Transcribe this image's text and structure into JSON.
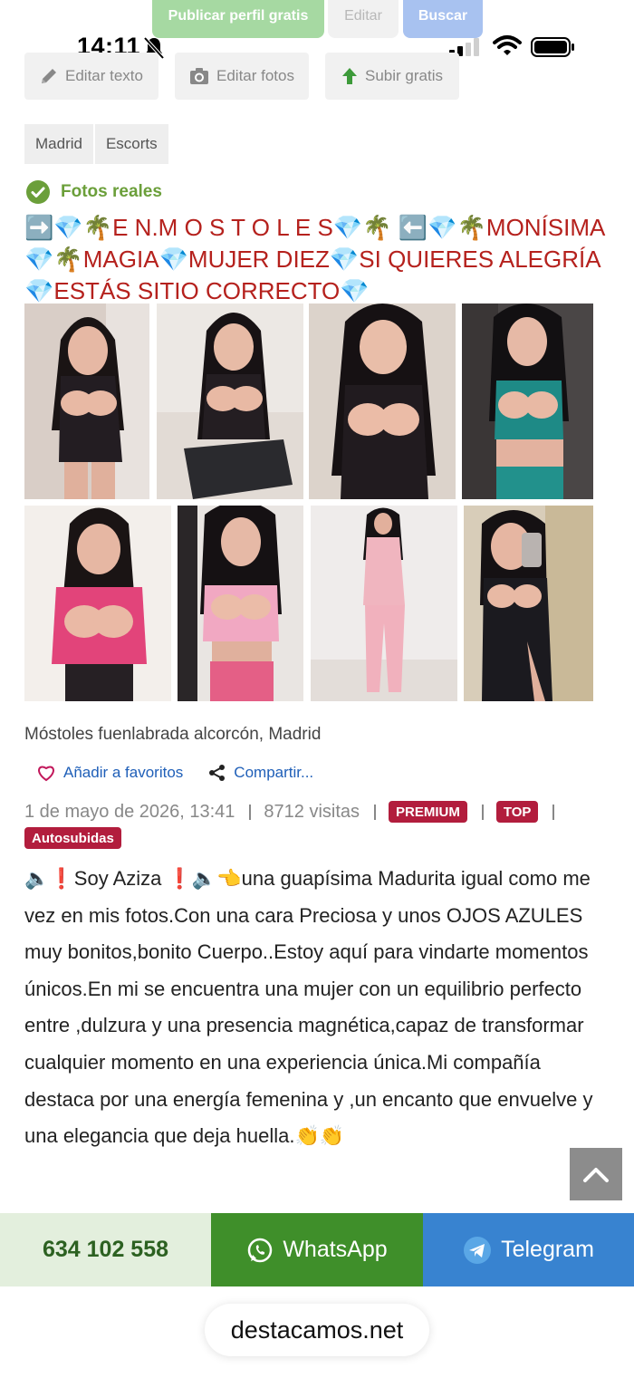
{
  "top_actions": {
    "publish_label": "Publicar perfil gratis",
    "edit_label": "Editar",
    "search_label": "Buscar"
  },
  "status_bar": {
    "time": "14:11"
  },
  "edit_toolbar": {
    "edit_text": "Editar texto",
    "edit_photos": "Editar fotos",
    "upload_free": "Subir gratis"
  },
  "breadcrumb": [
    "Madrid",
    "Escorts"
  ],
  "verified_label": "Fotos reales",
  "title": "➡️💎🌴E N.M O S T O L E S💎🌴 ⬅️💎🌴MONÍSIMA 💎🌴MAGIA💎MUJER DIEZ💎SI QUIERES ALEGRÍA 💎ESTÁS SITIO CORRECTO💎",
  "location": "Móstoles fuenlabrada alcorcón, Madrid",
  "actions": {
    "favorite": "Añadir a favoritos",
    "share": "Compartir..."
  },
  "meta": {
    "date": "1 de mayo de 2026, 13:41",
    "visits": "8712 visitas",
    "badges": [
      "PREMIUM",
      "TOP",
      "Autosubidas"
    ]
  },
  "description": "🔈❗Soy Aziza ❗🔈👈una guapísima Madurita igual como me vez en mis fotos.Con una cara Preciosa y unos OJOS AZULES muy bonitos,bonito Cuerpo..Estoy aquí para vindarte momentos únicos.En mi se encuentra una mujer con un equilibrio perfecto entre ,dulzura y una presencia magnética,capaz de transformar cualquier momento en una experiencia única.Mi compañía destaca por una energía femenina y ,un encanto que envuelve y una elegancia que deja huella.👏👏",
  "contact": {
    "phone": "634 102 558",
    "whatsapp": "WhatsApp",
    "telegram": "Telegram"
  },
  "browser": {
    "url": "destacamos.net"
  },
  "colors": {
    "title_red": "#b5211d",
    "verified_green": "#6b9f3a",
    "badge_red": "#b21d3d",
    "whatsapp_green": "#3f8f2a",
    "telegram_blue": "#3883d0",
    "link_blue": "#1f5fb8"
  },
  "icons": [
    "pencil-icon",
    "camera-icon",
    "arrow-up-icon",
    "check-circle-icon",
    "heart-icon",
    "share-icon",
    "chevron-up-icon",
    "whatsapp-icon",
    "telegram-icon",
    "bell-slash-icon",
    "signal-icon",
    "wifi-icon",
    "battery-icon"
  ]
}
